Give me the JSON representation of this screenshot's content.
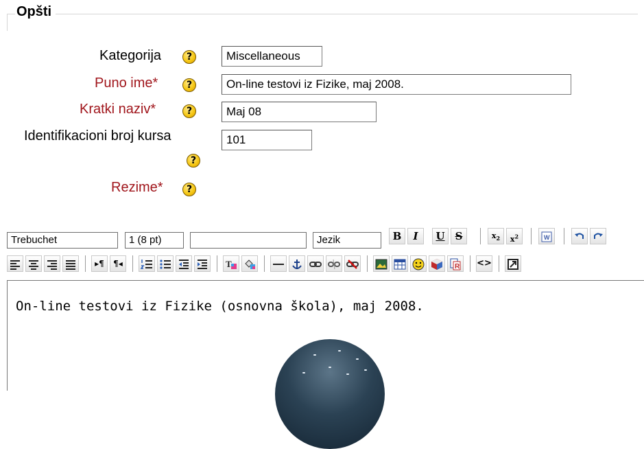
{
  "fieldset": {
    "legend": "Opšti"
  },
  "form": {
    "category": {
      "label": "Kategorija",
      "value": "Miscellaneous"
    },
    "fullname": {
      "label": "Puno ime",
      "required_mark": "*",
      "value": "On-line testovi iz Fizike, maj 2008."
    },
    "shortname": {
      "label": "Kratki naziv",
      "required_mark": "*",
      "value": "Maj 08"
    },
    "idnumber": {
      "label": "Identifikacioni broj kursa",
      "value": "101"
    },
    "summary": {
      "label": "Rezime",
      "required_mark": "*"
    },
    "help_glyph": "?"
  },
  "toolbar": {
    "font_family": "Trebuchet",
    "font_size": "1 (8 pt)",
    "format": "",
    "language": "Jezik",
    "bold": "B",
    "italic": "I",
    "underline": "U",
    "strike": "S"
  },
  "editor": {
    "content": "On-line testovi iz Fizike (osnovna škola), maj 2008."
  },
  "colors": {
    "required_label": "#a0151b",
    "help_icon": "#f6c814",
    "border": "#777777"
  },
  "icons": [
    "subscript-icon",
    "superscript-icon",
    "paste-word-icon",
    "undo-icon",
    "redo-icon",
    "align-left-icon",
    "align-center-icon",
    "align-right-icon",
    "justify-icon",
    "ltr-icon",
    "rtl-icon",
    "ordered-list-icon",
    "unordered-list-icon",
    "outdent-icon",
    "indent-icon",
    "text-color-icon",
    "background-color-icon",
    "horizontal-rule-icon",
    "anchor-icon",
    "link-icon",
    "unlink-icon",
    "nolink-icon",
    "image-icon",
    "table-icon",
    "smiley-icon",
    "special-char-icon",
    "search-replace-icon",
    "html-source-icon",
    "fullscreen-icon"
  ]
}
